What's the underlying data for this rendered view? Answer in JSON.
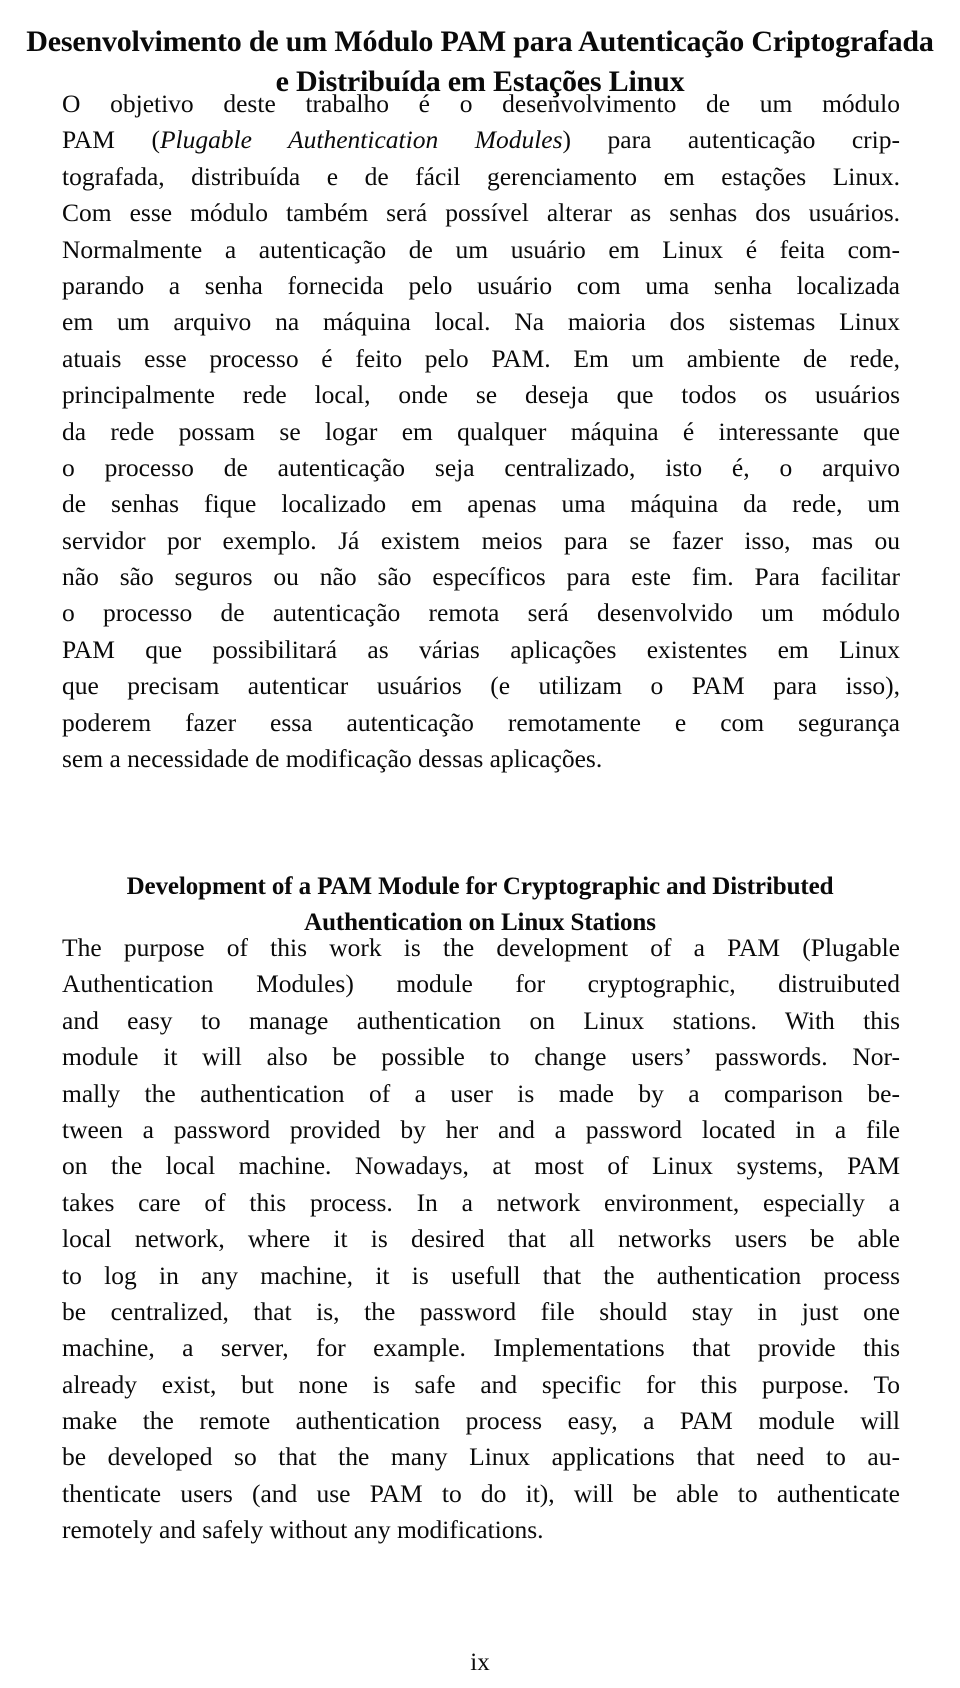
{
  "document": {
    "kind": "thesis-abstract-page",
    "page_number": "ix"
  },
  "title_pt": {
    "line1": "Desenvolvimento de um Módulo PAM para Autenticação Criptografada",
    "line2": "e Distribuída em Estações Linux"
  },
  "abstract_pt": {
    "full_text": "O objetivo deste trabalho é o desenvolvimento de um módulo PAM (Plugable Authentication Modules) para autenticação criptografada, distribuída e de fácil gerenciamento em estações Linux. Com esse módulo também será possível alterar as senhas dos usuários. Normalmente a autenticação de um usuário em Linux é feita comparando a senha fornecida pelo usuário com uma senha localizada em um arquivo na máquina local. Na maioria dos sistemas Linux atuais esse processo é feito pelo PAM. Em um ambiente de rede, principalmente rede local, onde se deseja que todos os usuários da rede possam se logar em qualquer máquina é interessante que o processo de autenticação seja centralizado, isto é, o arquivo de senhas fique localizado em apenas uma máquina da rede, um servidor por exemplo. Já existem meios para se fazer isso, mas ou não são seguros ou não são específicos para este fim. Para facilitar o processo de autenticação remota será desenvolvido um módulo PAM que possibilitará as várias aplicações existentes em Linux que precisam autenticar usuários (e utilizam o PAM para isso), poderem fazer essa autenticação remotamente e com segurança sem a necessidade de modificação dessas aplicações.",
    "lines": [
      "O objetivo deste trabalho é o desenvolvimento de um módulo",
      "PAM (Plugable Authentication Modules) para autenticação crip-",
      "tografada, distribuída e de fácil gerenciamento em estações Linux.",
      "Com esse módulo também será possível alterar as senhas dos usuários.",
      "Normalmente a autenticação de um usuário em Linux é feita com-",
      "parando a senha fornecida pelo usuário com uma senha localizada",
      "em um arquivo na máquina local. Na maioria dos sistemas Linux",
      "atuais esse processo é feito pelo PAM. Em um ambiente de rede,",
      "principalmente rede local, onde se deseja que todos os usuários",
      "da rede possam se logar em qualquer máquina é interessante que",
      "o processo de autenticação seja centralizado, isto é, o arquivo",
      "de senhas fique localizado em apenas uma máquina da rede, um",
      "servidor por exemplo. Já existem meios para se fazer isso, mas ou",
      "não são seguros ou não são específicos para este fim. Para facilitar",
      "o processo de autenticação remota será desenvolvido um módulo",
      "PAM que possibilitará as várias aplicações existentes em Linux",
      "que precisam autenticar usuários (e utilizam o PAM para isso),",
      "poderem fazer essa autenticação remotamente e com segurança",
      "sem a necessidade de modificação dessas aplicações."
    ],
    "italic_phrase": "Plugable Authentication Modules"
  },
  "title_en": {
    "line1": "Development of a PAM Module for Cryptographic and Distributed",
    "line2": "Authentication on Linux Stations"
  },
  "abstract_en": {
    "full_text": "The purpose of this work is the development of a PAM (Plugable Authentication Modules) module for cryptographic, distruibuted and easy to manage authentication on Linux stations. With this module it will also be possible to change users' passwords. Normally the authentication of a user is made by a comparison between a password provided by her and a password located in a file on the local machine. Nowadays, at most of Linux systems, PAM takes care of this process. In a network environment, especially a local network, where it is desired that all networks users be able to log in any machine, it is usefull that the authentication process be centralized, that is, the password file should stay in just one machine, a server, for example. Implementations that provide this already exist, but none is safe and specific for this purpose. To make the remote authentication process easy, a PAM module will be developed so that the many Linux applications that need to authenticate users (and use PAM to do it), will be able to authenticate remotely and safely without any modifications.",
    "lines": [
      "The purpose of this work is the development of a PAM (Plugable",
      "Authentication Modules) module for cryptographic, distruibuted",
      "and easy to manage authentication on Linux stations. With this",
      "module it will also be possible to change users’ passwords. Nor-",
      "mally the authentication of a user is made by a comparison be-",
      "tween a password provided by her and a password located in a file",
      "on the local machine. Nowadays, at most of Linux systems, PAM",
      "takes care of this process. In a network environment, especially a",
      "local network, where it is desired that all networks users be able",
      "to log in any machine, it is usefull that the authentication process",
      "be centralized, that is, the password file should stay in just one",
      "machine, a server, for example. Implementations that provide this",
      "already exist, but none is safe and specific for this purpose. To",
      "make the remote authentication process easy, a PAM module will",
      "be developed so that the many Linux applications that need to au-",
      "thenticate users (and use PAM to do it), will be able to authenticate",
      "remotely and safely without any modifications."
    ]
  },
  "folio": {
    "label": "ix"
  }
}
